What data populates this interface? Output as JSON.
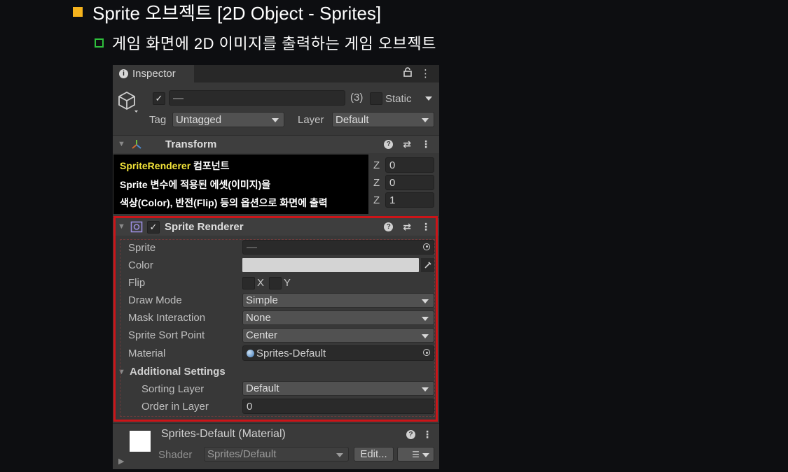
{
  "slide": {
    "title": "Sprite 오브젝트 [2D Object - Sprites]",
    "subtitle": "게임 화면에 2D 이미지를 출력하는 게임 오브젝트"
  },
  "inspector": {
    "tab_label": "Inspector",
    "object": {
      "name": "—",
      "count": "(3)",
      "static_label": "Static",
      "tag_label": "Tag",
      "tag_value": "Untagged",
      "layer_label": "Layer",
      "layer_value": "Default"
    },
    "transform": {
      "title": "Transform",
      "z_label": "Z",
      "z_values": [
        "0",
        "0",
        "1"
      ]
    },
    "note": {
      "title": "SpriteRenderer",
      "title_suffix": " 컴포넌트",
      "line1": "Sprite 변수에 적용된 에셋(이미지)을",
      "line2": "색상(Color), 반전(Flip) 등의 옵션으로 화면에 출력"
    },
    "sprite_renderer": {
      "title": "Sprite Renderer",
      "sprite_label": "Sprite",
      "sprite_value": "—",
      "color_label": "Color",
      "color_value": "#d4d4d4",
      "flip_label": "Flip",
      "flip_x": "X",
      "flip_y": "Y",
      "draw_mode_label": "Draw Mode",
      "draw_mode_value": "Simple",
      "mask_label": "Mask Interaction",
      "mask_value": "None",
      "sort_point_label": "Sprite Sort Point",
      "sort_point_value": "Center",
      "material_label": "Material",
      "material_value": "Sprites-Default",
      "additional_label": "Additional Settings",
      "sorting_layer_label": "Sorting Layer",
      "sorting_layer_value": "Default",
      "order_label": "Order in Layer",
      "order_value": "0"
    },
    "material": {
      "title": "Sprites-Default (Material)",
      "shader_label": "Shader",
      "shader_value": "Sprites/Default",
      "edit_label": "Edit..."
    }
  },
  "colors": {
    "highlight_frame": "#cc1418",
    "title_bullet": "#f5b31d",
    "sub_bullet": "#2fbf3c",
    "note_title": "#f5e63a"
  }
}
